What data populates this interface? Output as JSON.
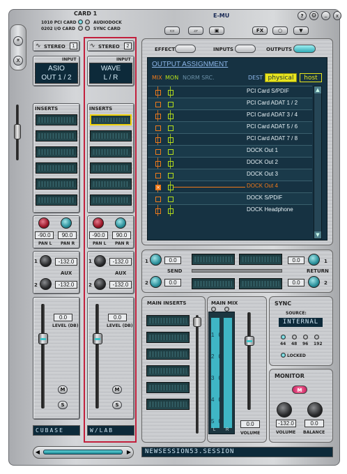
{
  "header": {
    "card_title": "CARD 1",
    "pci_card": "1010 PCI CARD",
    "io_card": "0202 I/O CARD",
    "audiodock": "AUDIODOCK",
    "sync_card": "SYNC CARD",
    "brand": "E-MU"
  },
  "toolbar": {
    "new_icon": "new-file-icon",
    "open_icon": "open-folder-icon",
    "save_icon": "save-disk-icon",
    "fx_label": "FX",
    "circle_icon": "circle-icon",
    "menu_icon": "triangle-down-icon"
  },
  "window_buttons": {
    "help": "?",
    "settings": "gear-icon",
    "minimize": "_",
    "close": "x"
  },
  "side_buttons": {
    "star": "*",
    "close": "x"
  },
  "tabs": {
    "effect": "EFFECT",
    "inputs": "INPUTS",
    "outputs": "OUTPUTS",
    "active": "outputs"
  },
  "strips": [
    {
      "type": "STEREO",
      "number": "1",
      "input_label": "INPUT",
      "input_name_1": "ASIO",
      "input_name_2": "OUT 1 / 2",
      "inserts": "INSERTS",
      "pan_l": "-90.0",
      "pan_r": "90.0",
      "pan_l_lbl": "PAN L",
      "pan_r_lbl": "PAN R",
      "aux_1": "-132.0",
      "aux_2": "-132.0",
      "aux_lbl": "AUX",
      "level": "0.0",
      "level_lbl": "LEVEL (DB)",
      "mute": "M",
      "solo": "S",
      "name": "CUBASE",
      "selected": false
    },
    {
      "type": "STEREO",
      "number": "2",
      "input_label": "INPUT",
      "input_name_1": "WAVE",
      "input_name_2": "L / R",
      "inserts": "INSERTS",
      "pan_l": "-90.0",
      "pan_r": "90.0",
      "pan_l_lbl": "PAN L",
      "pan_r_lbl": "PAN R",
      "aux_1": "-132.0",
      "aux_2": "-132.0",
      "aux_lbl": "AUX",
      "level": "0.0",
      "level_lbl": "LEVEL (DB)",
      "mute": "M",
      "solo": "S",
      "name": "W/LAB",
      "selected": true
    }
  ],
  "aux_numbers": [
    "1",
    "2"
  ],
  "output": {
    "title": "OUTPUT ASSIGNMENT",
    "mix": "MIX",
    "mon": "MON",
    "norm": "NORM SRC.",
    "dest": "DEST",
    "physical": "physical",
    "host": "host",
    "rows": [
      {
        "name": "PCI Card S/PDIF",
        "highlight": false
      },
      {
        "name": "PCI Card ADAT 1 / 2",
        "highlight": false
      },
      {
        "name": "PCI Card ADAT 3 / 4",
        "highlight": false
      },
      {
        "name": "PCI Card ADAT 5 / 6",
        "highlight": false
      },
      {
        "name": "PCI Card ADAT 7 / 8",
        "highlight": false
      },
      {
        "name": "DOCK Out 1",
        "highlight": false
      },
      {
        "name": "DOCK Out 2",
        "highlight": false
      },
      {
        "name": "DOCK Out 3",
        "highlight": false
      },
      {
        "name": "DOCK Out 4",
        "highlight": true
      },
      {
        "name": "DOCK S/PDIF",
        "highlight": false
      },
      {
        "name": "DOCK Headphone",
        "highlight": false
      }
    ]
  },
  "send": {
    "label": "SEND",
    "return_label": "RETURN",
    "send_1": "0.0",
    "send_2": "0.0",
    "return_1": "0.0",
    "return_2": "0.0",
    "n1": "1",
    "n2": "2"
  },
  "main_inserts": {
    "label": "MAIN INSERTS"
  },
  "main_mix": {
    "label": "MAIN MIX",
    "ticks": [
      "10",
      "20",
      "30",
      "40",
      "50"
    ],
    "meter_l": "L",
    "meter_r": "R",
    "volume": "0.0",
    "volume_lbl": "VOLUME",
    "level_l": 0.95,
    "level_r": 0.95
  },
  "sync": {
    "label": "SYNC",
    "source_lbl": "SOURCE:",
    "source": "INTERNAL",
    "rates": [
      "44",
      "48",
      "96",
      "192"
    ],
    "active_rate": "44",
    "locked": "LOCKED"
  },
  "monitor": {
    "label": "MONITOR",
    "mute": "M",
    "volume": "-132.0",
    "balance": "0.0",
    "volume_lbl": "VOLUME",
    "balance_lbl": "BALANCE"
  },
  "session": {
    "name": "NEWSESSION53.SESSION"
  },
  "colors": {
    "accent": "#3ec4c8",
    "lcd": "#0d2a3a",
    "mix": "#f07a1a",
    "mon": "#b8e01a",
    "select": "#c21f3c"
  }
}
